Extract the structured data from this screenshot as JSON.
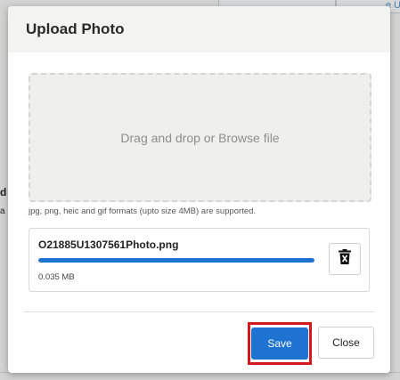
{
  "background": {
    "edge_text_1": "d",
    "edge_text_2": "a",
    "edge_text_3": "e U"
  },
  "modal": {
    "title": "Upload Photo"
  },
  "dropzone": {
    "text": "Drag and drop or Browse file"
  },
  "formats_note": "jpg, png, heic and gif formats (upto size 4MB) are supported.",
  "file": {
    "name": "O21885U1307561Photo.png",
    "size": "0.035 MB",
    "upload_progress": 1.0
  },
  "buttons": {
    "save": "Save",
    "close": "Close"
  },
  "icons": {
    "delete": "trash-icon"
  },
  "colors": {
    "primary": "#1e73d2",
    "highlight": "#d3191c",
    "header_bg": "#f3f3f1"
  }
}
